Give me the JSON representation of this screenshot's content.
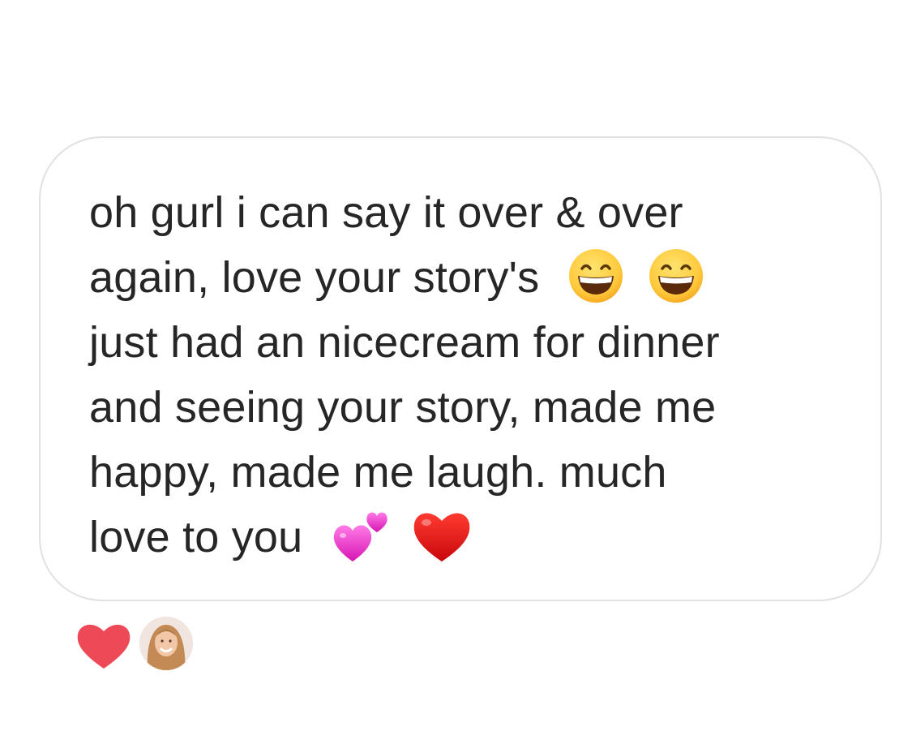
{
  "message": {
    "lines": [
      "oh gurl i can say it over & over",
      "again, love your story's",
      "just had an nicecream for dinner",
      "and seeing your story, made me",
      "happy, made me laugh. much",
      "love to you"
    ],
    "line2_emojis": [
      "grinning-face-emoji",
      "grinning-face-emoji"
    ],
    "line6_emojis": [
      "two-hearts-emoji",
      "red-heart-emoji"
    ]
  },
  "reactions": {
    "heart_icon": "heart-icon",
    "heart_color": "#ed4956",
    "reactor_avatar": "avatar"
  },
  "colors": {
    "bubble_border": "#e1e1e1",
    "text": "#262626",
    "background": "#ffffff"
  }
}
